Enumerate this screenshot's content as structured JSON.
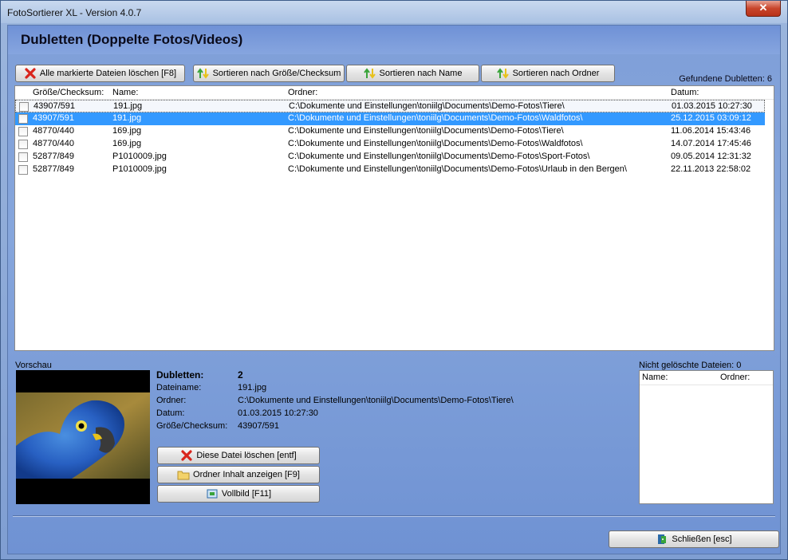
{
  "window": {
    "title": "FotoSortierer XL - Version 4.0.7",
    "close_glyph": "✕"
  },
  "page": {
    "title": "Dubletten (Doppelte Fotos/Videos)"
  },
  "toolbar": {
    "delete_marked": "Alle markierte Dateien löschen [F8]",
    "sort_size": "Sortieren nach Größe/Checksum",
    "sort_name": "Sortieren nach Name",
    "sort_folder": "Sortieren nach Ordner"
  },
  "found": "Gefundene Dubletten: 6",
  "columns": {
    "size": "Größe/Checksum:",
    "name": "Name:",
    "folder": "Ordner:",
    "date": "Datum:"
  },
  "rows": [
    {
      "size": "43907/591",
      "name": "191.jpg",
      "folder": "C:\\Dokumente und Einstellungen\\toniilg\\Documents\\Demo-Fotos\\Tiere\\",
      "date": "01.03.2015 10:27:30"
    },
    {
      "size": "43907/591",
      "name": "191.jpg",
      "folder": "C:\\Dokumente und Einstellungen\\toniilg\\Documents\\Demo-Fotos\\Waldfotos\\",
      "date": "25.12.2015 03:09:12"
    },
    {
      "size": "48770/440",
      "name": "169.jpg",
      "folder": "C:\\Dokumente und Einstellungen\\toniilg\\Documents\\Demo-Fotos\\Tiere\\",
      "date": "11.06.2014 15:43:46"
    },
    {
      "size": "48770/440",
      "name": "169.jpg",
      "folder": "C:\\Dokumente und Einstellungen\\toniilg\\Documents\\Demo-Fotos\\Waldfotos\\",
      "date": "14.07.2014 17:45:46"
    },
    {
      "size": "52877/849",
      "name": "P1010009.jpg",
      "folder": "C:\\Dokumente und Einstellungen\\toniilg\\Documents\\Demo-Fotos\\Sport-Fotos\\",
      "date": "09.05.2014 12:31:32"
    },
    {
      "size": "52877/849",
      "name": "P1010009.jpg",
      "folder": "C:\\Dokumente und Einstellungen\\toniilg\\Documents\\Demo-Fotos\\Urlaub in den Bergen\\",
      "date": "22.11.2013 22:58:02"
    }
  ],
  "preview": {
    "label": "Vorschau"
  },
  "info": {
    "dubletten_label": "Dubletten:",
    "dubletten_value": "2",
    "filename_label": "Dateiname:",
    "filename_value": "191.jpg",
    "folder_label": "Ordner:",
    "folder_value": "C:\\Dokumente und Einstellungen\\toniilg\\Documents\\Demo-Fotos\\Tiere\\",
    "date_label": "Datum:",
    "date_value": "01.03.2015 10:27:30",
    "checksum_label": "Größe/Checksum:",
    "checksum_value": "43907/591"
  },
  "actions": {
    "delete_file": "Diese Datei löschen [entf]",
    "show_folder": "Ordner Inhalt anzeigen [F9]",
    "fullscreen": "Vollbild [F11]",
    "close": "Schließen [esc]"
  },
  "deleted": {
    "label": "Nicht gelöschte Dateien: 0",
    "col_name": "Name:",
    "col_folder": "Ordner:"
  },
  "colors": {
    "selection": "#3399ff",
    "delete_icon": "#d9251c",
    "sort_icon_green": "#3aa43a",
    "sort_icon_yellow": "#e8c21b"
  }
}
